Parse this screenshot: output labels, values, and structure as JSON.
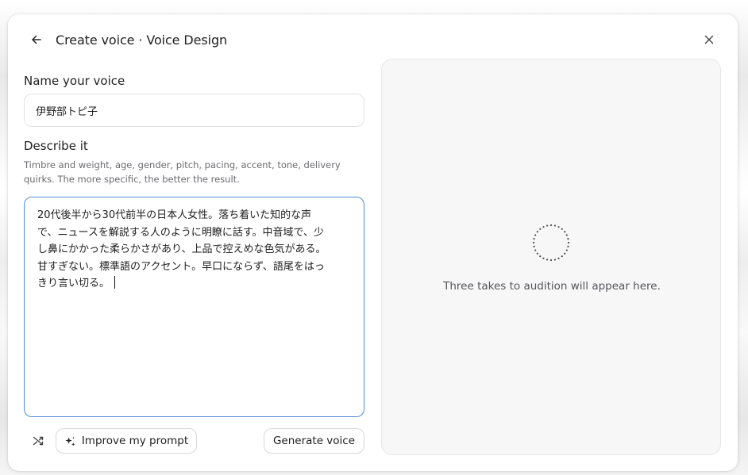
{
  "header": {
    "title": "Create voice · Voice Design"
  },
  "name_section": {
    "label": "Name your voice",
    "value": "伊野部トピ子"
  },
  "describe_section": {
    "label": "Describe it",
    "hint": "Timbre and weight, age, gender, pitch, pacing, accent, tone, delivery quirks. The more specific, the better the result.",
    "lines": [
      "20代後半から30代前半の日本人女性。落ち着いた知的な声",
      "で、ニュースを解説する人のように明瞭に話す。中音域で、少",
      "し鼻にかかった柔らかさがあり、上品で控えめな色気がある。",
      "甘すぎない。標準語のアクセント。早口にならず、語尾をはっ",
      "きり言い切る。"
    ]
  },
  "actions": {
    "improve_label": "Improve my prompt",
    "generate_label": "Generate voice"
  },
  "preview": {
    "empty_text": "Three takes to audition will appear here."
  },
  "icons": {
    "back": "arrow-left-icon",
    "close": "close-icon",
    "shuffle": "shuffle-icon",
    "sparkle": "sparkle-icon",
    "loading": "dotted-spinner-icon"
  },
  "colors": {
    "focus_border": "#4f8fd9",
    "panel_bg": "#f7f7f8"
  }
}
